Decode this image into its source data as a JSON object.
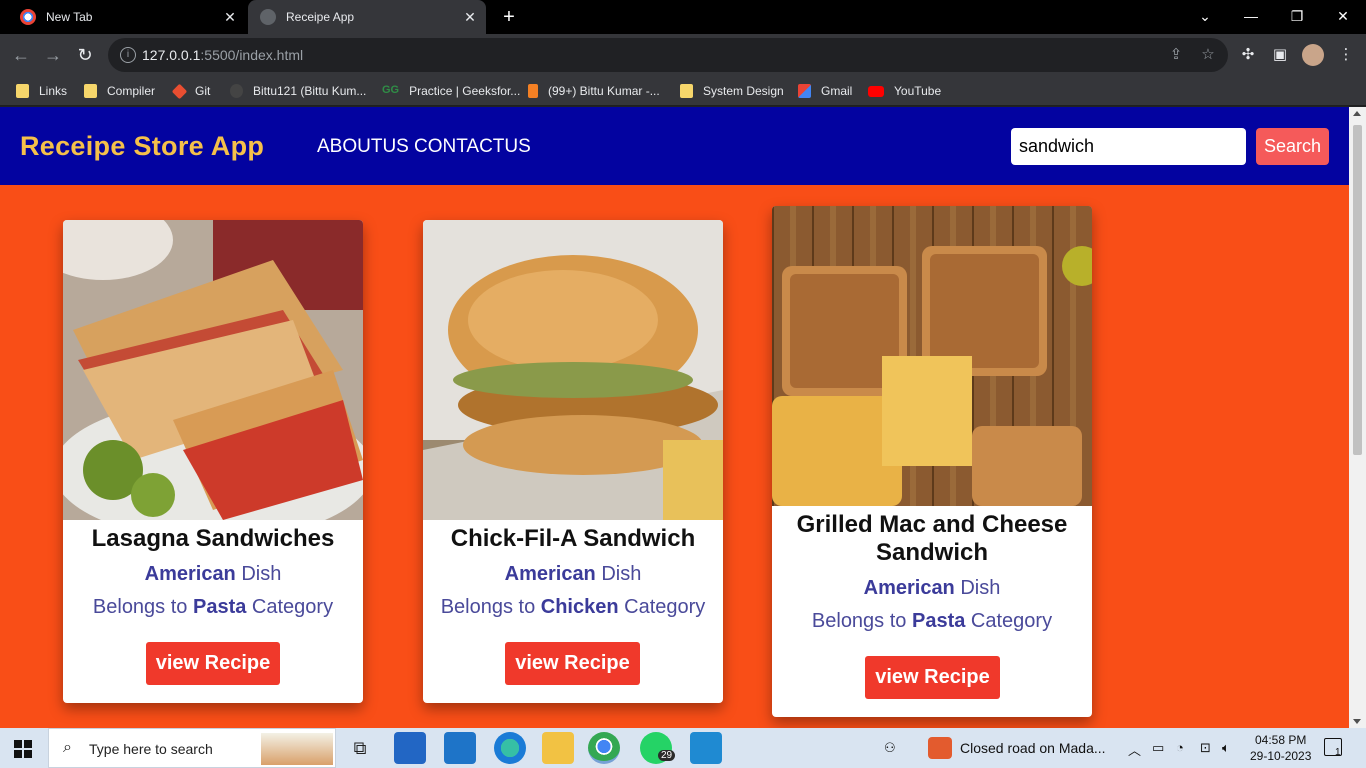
{
  "browser": {
    "tabs": [
      {
        "title": "New Tab",
        "active": false
      },
      {
        "title": "Receipe App",
        "active": true
      }
    ],
    "url": {
      "host": "127.0.0.1",
      "rest": ":5500/index.html"
    },
    "bookmarks": [
      {
        "label": "Links",
        "icon": "folder-icon"
      },
      {
        "label": "Compiler",
        "icon": "folder-icon"
      },
      {
        "label": "Git",
        "icon": "git-icon"
      },
      {
        "label": "Bittu121 (Bittu Kum...",
        "icon": "github-icon"
      },
      {
        "label": "Practice | Geeksfor...",
        "icon": "geeksforgeeks-icon"
      },
      {
        "label": "(99+) Bittu Kumar -...",
        "icon": "stackoverflow-icon"
      },
      {
        "label": "System Design",
        "icon": "folder-icon"
      },
      {
        "label": "Gmail",
        "icon": "gmail-icon"
      },
      {
        "label": "YouTube",
        "icon": "youtube-icon"
      }
    ]
  },
  "app": {
    "brand": "Receipe Store App",
    "nav": [
      "ABOUTUS",
      "CONTACTUS"
    ],
    "search": {
      "value": "sandwich",
      "button": "Search"
    },
    "colors": {
      "navbar": "#0303a0",
      "page_bg": "#f94e17",
      "brand": "#f5c04a",
      "button": "#f0392b"
    },
    "cards": [
      {
        "title": "Lasagna Sandwiches",
        "area": "American",
        "area_suffix": " Dish",
        "cat_prefix": "Belongs to ",
        "category": "Pasta",
        "cat_suffix": " Category",
        "button": "view Recipe"
      },
      {
        "title": "Chick-Fil-A Sandwich",
        "area": "American",
        "area_suffix": " Dish",
        "cat_prefix": "Belongs to ",
        "category": "Chicken",
        "cat_suffix": " Category",
        "button": "view Recipe"
      },
      {
        "title": "Grilled Mac and Cheese Sandwich",
        "area": "American",
        "area_suffix": " Dish",
        "cat_prefix": "Belongs to ",
        "category": "Pasta",
        "cat_suffix": " Category",
        "button": "view Recipe"
      }
    ]
  },
  "taskbar": {
    "search_placeholder": "Type here to search",
    "whatsapp_badge": "29",
    "notification_text": "Closed road on Mada...",
    "time": "04:58 PM",
    "date": "29-10-2023",
    "notification_count": "1"
  }
}
